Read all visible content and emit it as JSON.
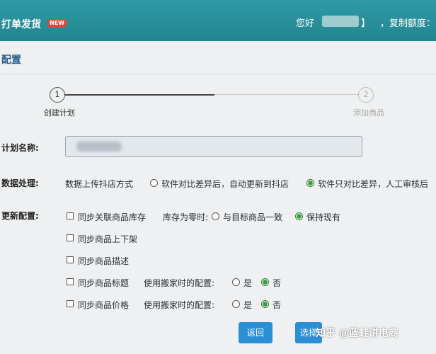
{
  "header": {
    "app_title": "打单发货",
    "new_badge": "NEW",
    "greeting": "您好",
    "bracket": "】",
    "quota_label": "，复制额度：已"
  },
  "section": {
    "title": "配置"
  },
  "steps": [
    {
      "number": "1",
      "label": "创建计划"
    },
    {
      "number": "2",
      "label": "添加商品"
    }
  ],
  "form": {
    "plan_name_label": "计划名称:",
    "data_label": "数据处理:",
    "data_method": "数据上传抖店方式",
    "data_options": [
      "软件对比差异后，自动更新到抖店",
      "软件只对比差异，人工审核后"
    ],
    "update_label": "更新配置:",
    "sync_stock": "同步关联商品库存",
    "stock_zero_label": "库存为零时:",
    "stock_options": [
      "与目标商品一致",
      "保持现有"
    ],
    "sync_shelf": "同步商品上下架",
    "sync_desc": "同步商品描述",
    "sync_title": "同步商品标题",
    "sync_price": "同步商品价格",
    "move_config_label": "使用搬家时的配置:",
    "yes": "是",
    "no": "否"
  },
  "buttons": {
    "back": "返回",
    "next": "选择"
  },
  "watermark": "知乎 @蓝蛙讲电商",
  "colors": {
    "header": "#2a939e",
    "primary_button": "#2b8fd6",
    "radio_selected": "#3d9b3d"
  }
}
